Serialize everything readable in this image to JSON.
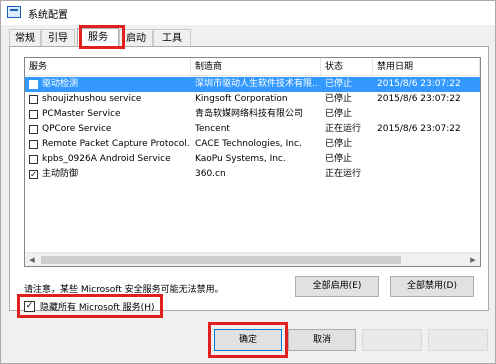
{
  "window": {
    "title": "系统配置"
  },
  "tabs": [
    "常规",
    "引导",
    "服务",
    "启动",
    "工具"
  ],
  "list": {
    "columns": [
      "服务",
      "制造商",
      "状态",
      "禁用日期"
    ],
    "rows": [
      {
        "name": "驱动检测",
        "maker": "深圳市驱动人生软件技术有限...",
        "status": "已停止",
        "date": "2015/8/6 23:07:22",
        "checked": false,
        "selected": true
      },
      {
        "name": "shoujizhushou service",
        "maker": "Kingsoft Corporation",
        "status": "已停止",
        "date": "2015/8/6 23:07:22",
        "checked": false,
        "selected": false
      },
      {
        "name": "PCMaster Service",
        "maker": "青岛软媒网络科技有限公司",
        "status": "已停止",
        "date": "",
        "checked": false,
        "selected": false
      },
      {
        "name": "QPCore Service",
        "maker": "Tencent",
        "status": "正在运行",
        "date": "2015/8/6 23:07:22",
        "checked": false,
        "selected": false
      },
      {
        "name": "Remote Packet Capture Protocol...",
        "maker": "CACE Technologies, Inc.",
        "status": "已停止",
        "date": "",
        "checked": false,
        "selected": false
      },
      {
        "name": "kpbs_0926A Android Service",
        "maker": "KaoPu Systems, Inc.",
        "status": "已停止",
        "date": "",
        "checked": false,
        "selected": false
      },
      {
        "name": "主动防御",
        "maker": "360.cn",
        "status": "正在运行",
        "date": "",
        "checked": true,
        "selected": false
      }
    ]
  },
  "note": "请注意，某些 Microsoft 安全服务可能无法禁用。",
  "buttons": {
    "enable_all": "全部启用(E)",
    "disable_all": "全部禁用(D)",
    "ok": "确定",
    "cancel": "取消"
  },
  "hide_ms": {
    "label": "隐藏所有 Microsoft 服务(H)",
    "checked": true
  },
  "colors": {
    "highlight": "#e0201f",
    "selection": "#3399ff"
  }
}
